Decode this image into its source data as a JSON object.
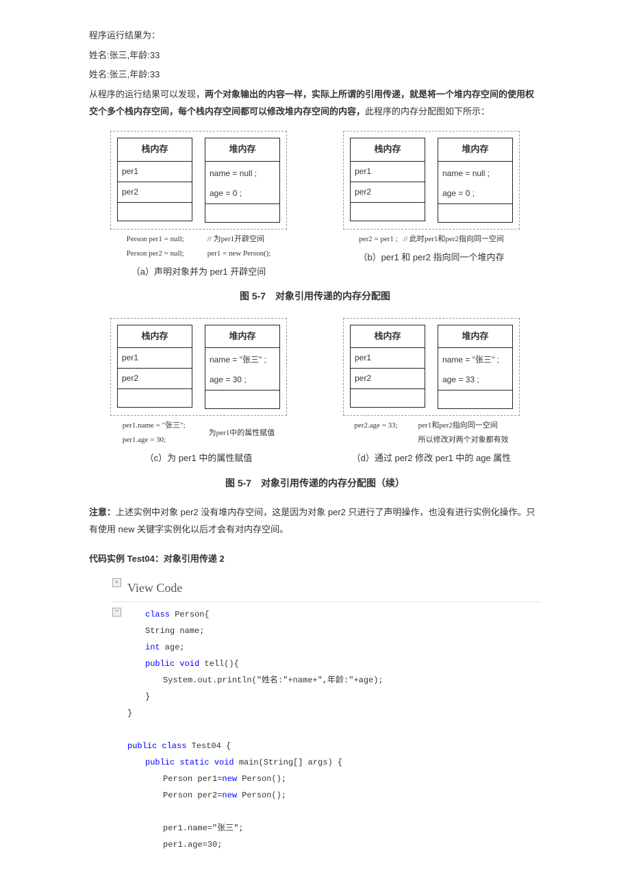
{
  "intro": {
    "l1": "程序运行结果为：",
    "l2": "姓名:张三,年龄:33",
    "l3": "姓名:张三,年龄:33",
    "l4a": "从程序的运行结果可以发现，",
    "l4b": "两个对象输出的内容一样，实际上所谓的引用传递，就是将一个堆内存空间的使用权交个多个栈内存空间，每个栈内存空间都可以修改堆内存空间的内容，",
    "l4c": "此程序的内存分配图如下所示："
  },
  "fig57": {
    "stackHdr": "栈内存",
    "heapHdr": "堆内存",
    "per1": "per1",
    "per2": "per2",
    "a": {
      "heap1": "name = null ;",
      "heap2": "age = 0 ;",
      "note1": "Person per1 = null;",
      "note2": "Person per2 = null;",
      "noteR1": "// 为per1开辟空间",
      "noteR2": "per1 = new Person();",
      "caption": "（a）声明对象并为 per1 开辟空间"
    },
    "b": {
      "heap1": "name = null ;",
      "heap2": "age = 0 ;",
      "noteL": "per2 = per1 ;",
      "noteR": "// 此时per1和per2指向同一空间",
      "caption": "（b）per1 和 per2 指向同一个堆内存"
    },
    "mainCaption": "图 5-7　对象引用传递的内存分配图",
    "c": {
      "heap1": "name = \"张三\" ;",
      "heap2": "age = 30 ;",
      "note1": "per1.name = \"张三\";",
      "note2": "per1.age = 30;",
      "noteR": "为per1中的属性赋值",
      "caption": "（c）为 per1 中的属性赋值"
    },
    "d": {
      "heap1": "name = \"张三\" ;",
      "heap2": "age = 33 ;",
      "noteL": "per2.age = 33;",
      "noteR1": "per1和per2指向同一空间",
      "noteR2": "所以修改对两个对象都有效",
      "caption": "（d）通过 per2 修改 per1 中的 age 属性"
    },
    "mainCaption2": "图 5-7　对象引用传递的内存分配图（续）"
  },
  "note": {
    "prefix": "注意：",
    "body": "上述实例中对象 per2 没有堆内存空间，这是因为对象 per2 只进行了声明操作，也没有进行实例化操作。只有使用 new 关键字实例化以后才会有对内存空间。"
  },
  "section2": {
    "titlePrefix": "代码实例 Test04：",
    "titleBody": "对象引用传递 2"
  },
  "code": {
    "viewCode": "View Code",
    "plus": "+",
    "minus": "−",
    "classKw": "class",
    "personName": " Person{",
    "stringName": "String name;",
    "intKw": "int",
    "age": " age;",
    "publicVoid": "public void",
    "tell": " tell(){",
    "println": "System.out.println(\"姓名:\"+name+\",年龄:\"+age);",
    "closeBrace": "}",
    "publicClass": "public class",
    "test04": " Test04 {",
    "psvMain": "public static void",
    "mainSig": " main(String[] args) {",
    "per1new1": "Person per1=",
    "newKw": "new",
    "per1new2": " Person();",
    "per2new1": "Person per2=",
    "per2new2": " Person();",
    "per1name": "per1.name=\"张三\";",
    "per1age": "per1.age=30;"
  }
}
